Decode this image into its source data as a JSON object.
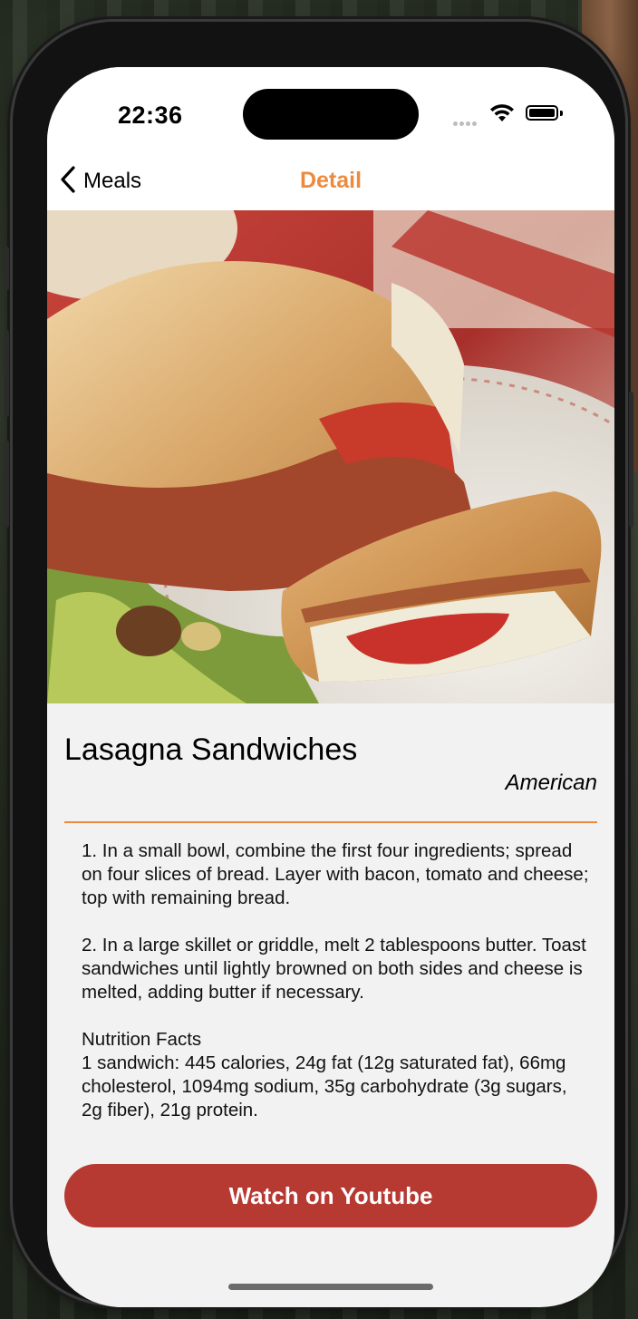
{
  "status_bar": {
    "time": "22:36",
    "icons": [
      "signal-dots-icon",
      "wifi-icon",
      "battery-icon"
    ]
  },
  "nav": {
    "back_label": "Meals",
    "title": "Detail",
    "back_icon": "chevron-left-icon"
  },
  "meal": {
    "image_alt": "grilled sandwich photo",
    "name": "Lasagna Sandwiches",
    "area": "American",
    "instructions": "1. In a small bowl, combine the first four ingredients; spread on four slices of bread. Layer with bacon, tomato and cheese; top with remaining bread.\n\n2. In a large skillet or griddle, melt 2 tablespoons butter. Toast sandwiches until lightly browned on both sides and cheese is melted, adding butter if necessary.\n\nNutrition Facts\n1 sandwich: 445 calories, 24g fat (12g saturated fat), 66mg cholesterol, 1094mg sodium, 35g carbohydrate (3g sugars, 2g fiber), 21g protein."
  },
  "actions": {
    "youtube_label": "Watch on Youtube"
  },
  "colors": {
    "accent": "#ee8a3c",
    "button": "#b63a32",
    "background": "#f2f2f2"
  }
}
